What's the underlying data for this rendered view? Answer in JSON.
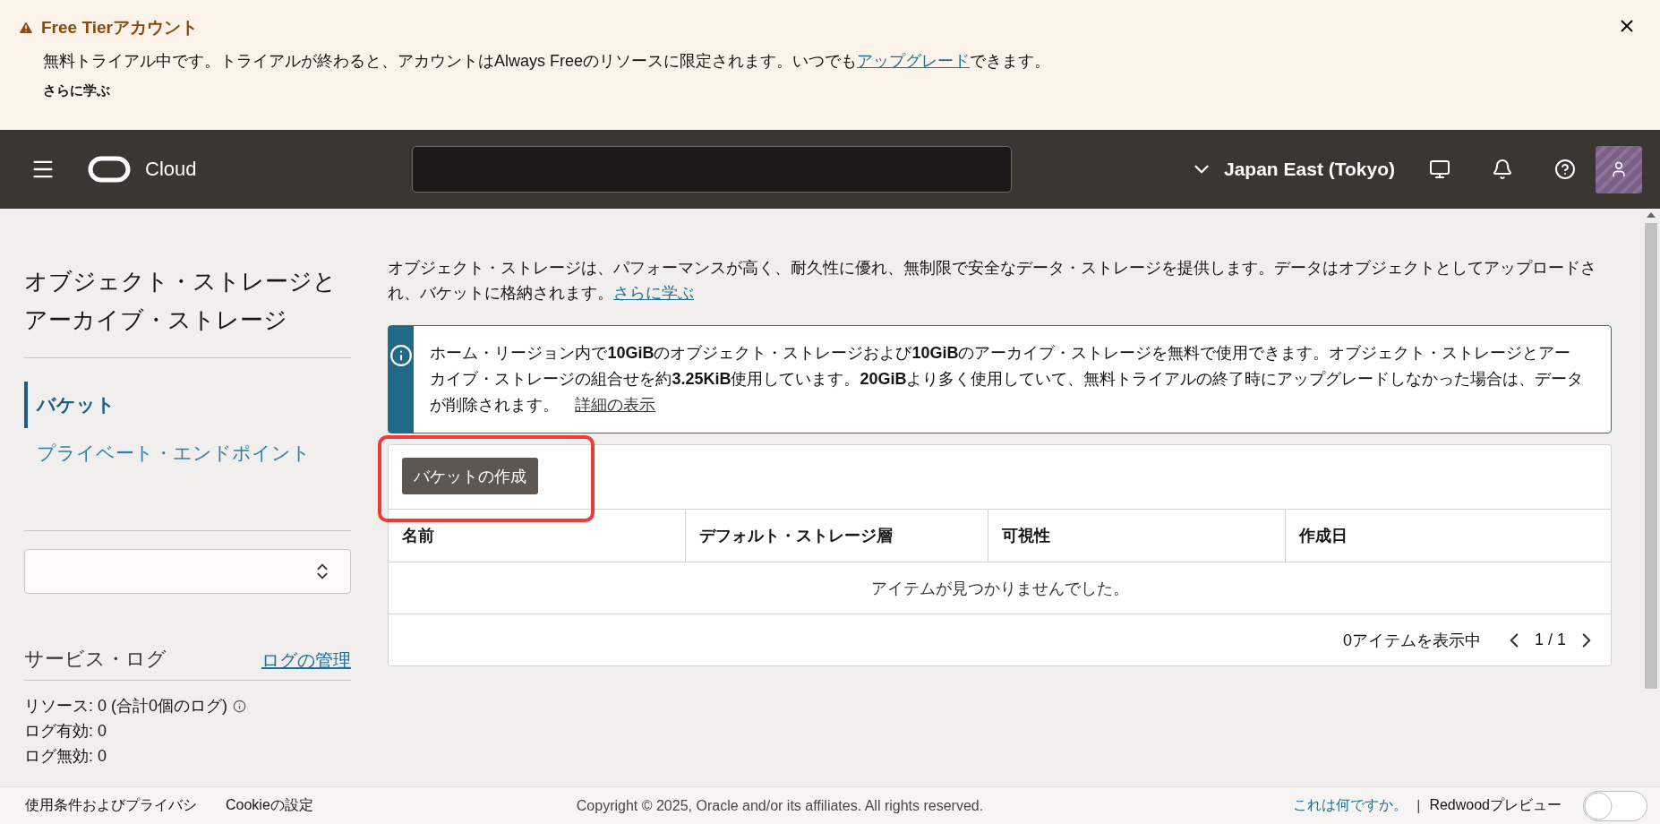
{
  "banner": {
    "title": "Free Tierアカウント",
    "message_before": "無料トライアル中です。トライアルが終わると、アカウントはAlways Freeのリソースに限定されます。いつでも",
    "message_link": "アップグレード",
    "message_after": "できます。",
    "learn_more": "さらに学ぶ"
  },
  "header": {
    "brand": "Cloud",
    "region": "Japan East (Tokyo)"
  },
  "sidebar": {
    "title": "オブジェクト・ストレージとアーカイブ・ストレージ",
    "items": [
      {
        "label": "バケット",
        "selected": true
      },
      {
        "label": "プライベート・エンドポイント",
        "selected": false
      }
    ],
    "logs": {
      "title": "サービス・ログ",
      "manage_link": "ログの管理",
      "resources": "リソース:  0 (合計0個のログ)",
      "enabled": "ログ有効:  0",
      "disabled": "ログ無効:  0"
    }
  },
  "main": {
    "intro": "オブジェクト・ストレージは、パフォーマンスが高く、耐久性に優れ、無制限で安全なデータ・ストレージを提供します。データはオブジェクトとしてアップロードされ、バケットに格納されます。",
    "intro_link": "さらに学ぶ",
    "info": "ホーム・リージョン内で**10GiB**のオブジェクト・ストレージおよび**10GiB**のアーカイブ・ストレージを無料で使用できます。オブジェクト・ストレージとアーカイブ・ストレージの組合せを約**3.25KiB**使用しています。**20GiB**より多く使用していて、無料トライアルの終了時にアップグレードしなかった場合は、データが削除されます。",
    "info_link": "詳細の表示",
    "create_button": "バケットの作成",
    "table": {
      "columns": [
        "名前",
        "デフォルト・ストレージ層",
        "可視性",
        "作成日"
      ],
      "empty": "アイテムが見つかりませんでした。",
      "count": "0アイテムを表示中",
      "page": "1 / 1"
    }
  },
  "footer": {
    "links": [
      "使用条件およびプライバシ",
      "Cookieの設定"
    ],
    "copyright": "Copyright © 2025, Oracle and/or its affiliates. All rights reserved.",
    "help_link": "これは何ですか。",
    "separator": "|",
    "preview_label": "Redwoodプレビュー",
    "preview_on": false
  }
}
